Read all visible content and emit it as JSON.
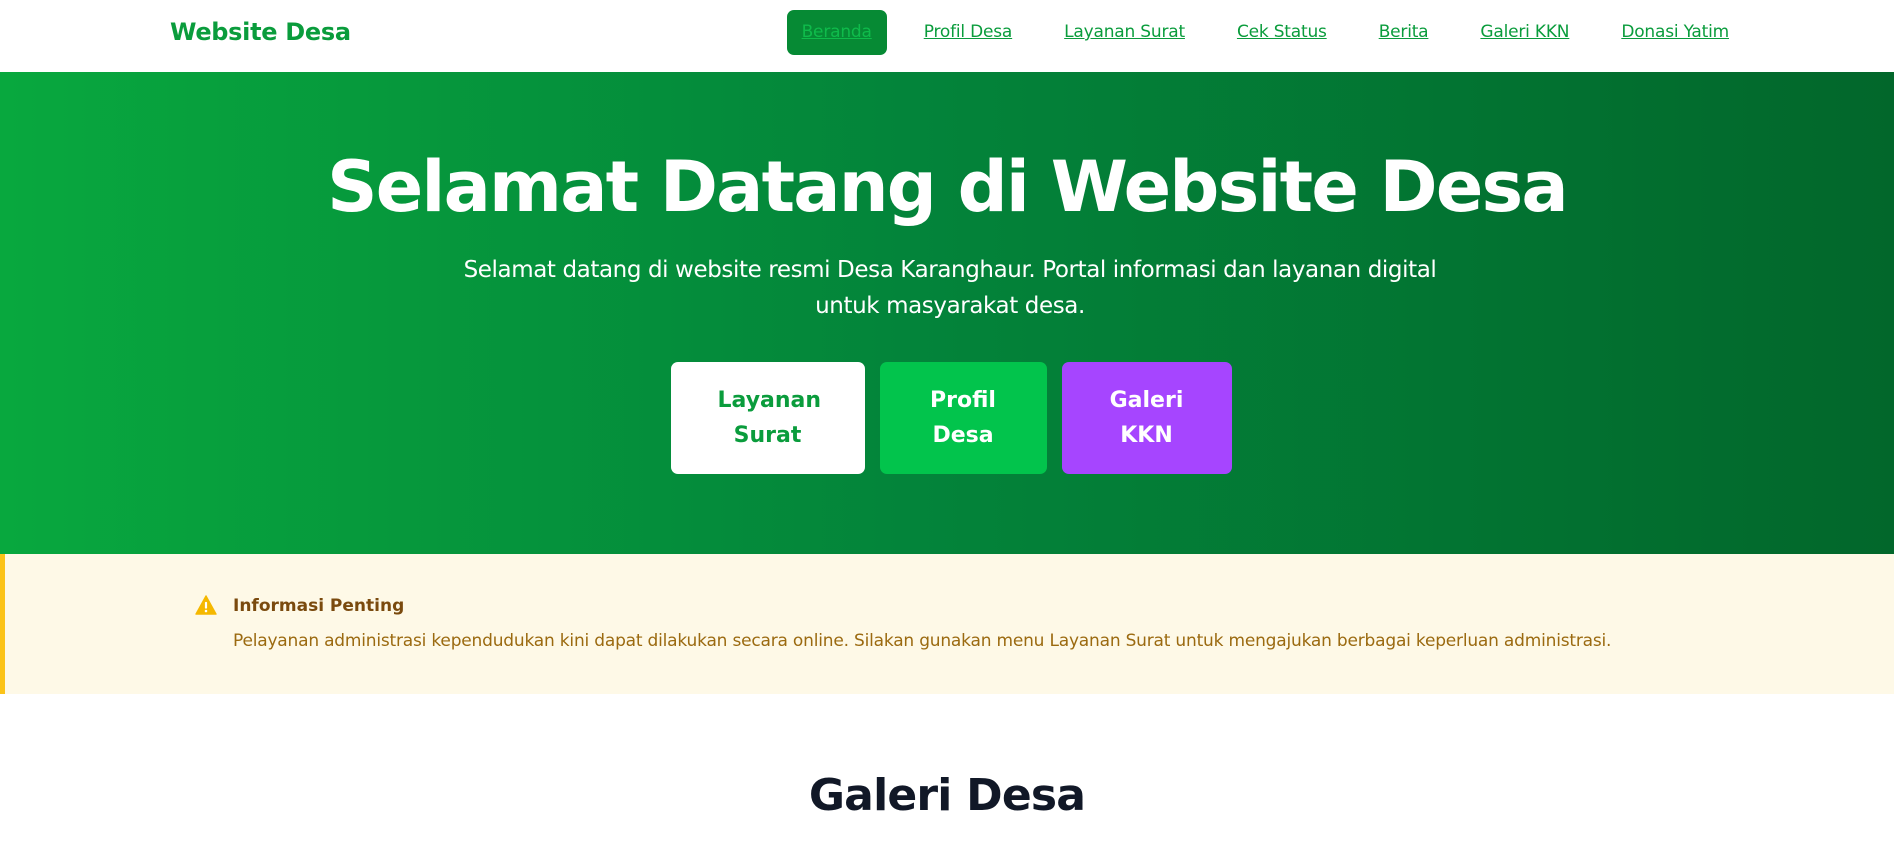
{
  "navbar": {
    "brand": "Website Desa",
    "links": [
      {
        "label": "Beranda",
        "active": true
      },
      {
        "label": "Profil Desa",
        "active": false
      },
      {
        "label": "Layanan Surat",
        "active": false
      },
      {
        "label": "Cek Status",
        "active": false
      },
      {
        "label": "Berita",
        "active": false
      },
      {
        "label": "Galeri KKN",
        "active": false
      },
      {
        "label": "Donasi Yatim",
        "active": false
      }
    ]
  },
  "hero": {
    "title": "Selamat Datang di Website Desa",
    "subtitle": "Selamat datang di website resmi Desa Karanghaur. Portal informasi dan layanan digital untuk masyarakat desa.",
    "buttons": [
      {
        "label": "Layanan Surat"
      },
      {
        "label": "Profil Desa"
      },
      {
        "label": "Galeri KKN"
      }
    ]
  },
  "alert": {
    "icon": "warning-icon",
    "title": "Informasi Penting",
    "text": "Pelayanan administrasi kependudukan kini dapat dilakukan secara online. Silakan gunakan menu Layanan Surat untuk mengajukan berbagai keperluan administrasi."
  },
  "gallery": {
    "title": "Galeri Desa"
  },
  "colors": {
    "brand_green": "#0a9c3c",
    "hero_start": "#08a83e",
    "hero_end": "#02672b",
    "profil_button": "#02c44c",
    "galeri_button": "#a645ff",
    "alert_bg": "#fef9e7",
    "alert_border": "#fbc318"
  }
}
